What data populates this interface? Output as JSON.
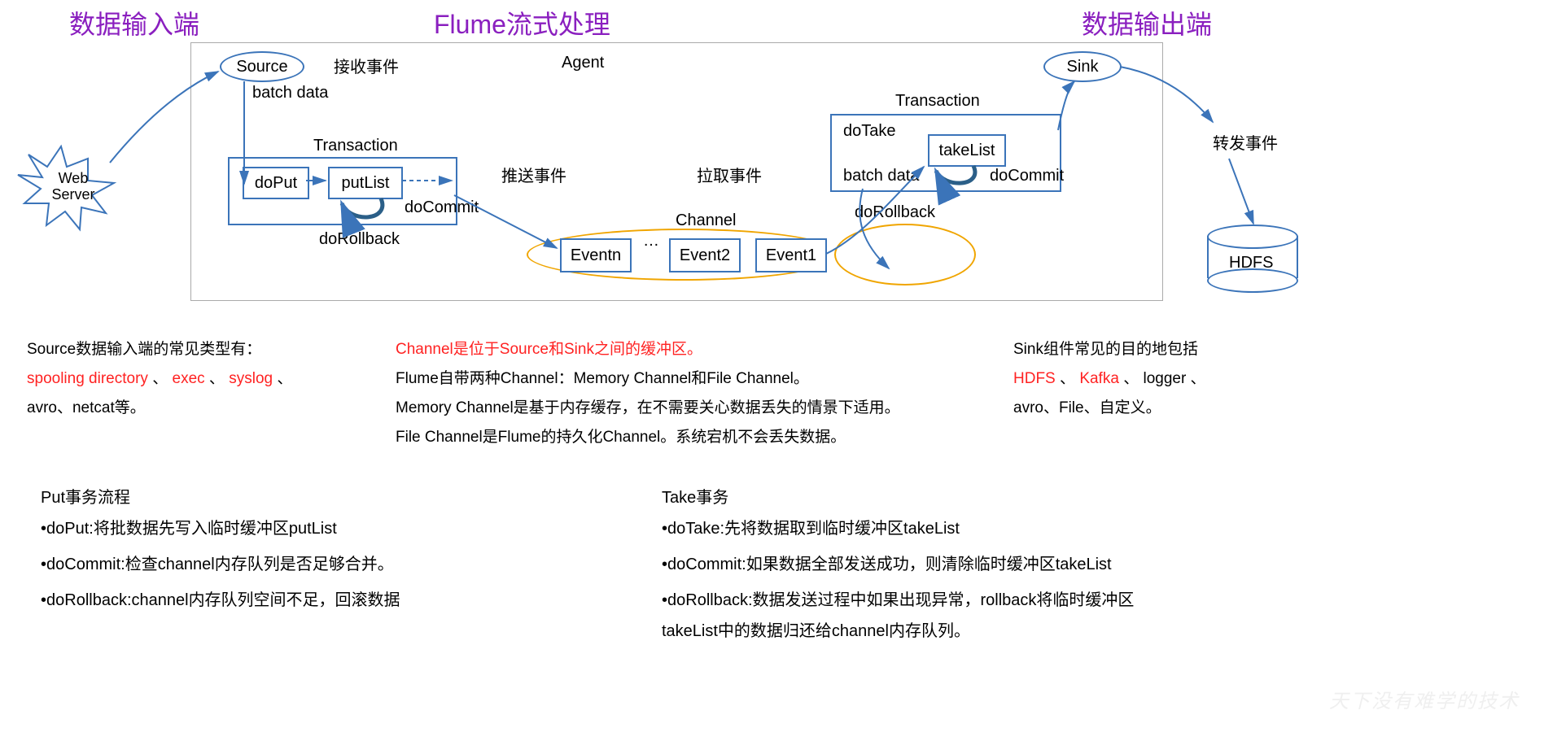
{
  "headers": {
    "left": "数据输入端",
    "center": "Flume流式处理",
    "right": "数据输出端"
  },
  "diagram": {
    "source": "Source",
    "sink": "Sink",
    "agent": "Agent",
    "recvEvent": "接收事件",
    "batchData1": "batch data",
    "txn1": "Transaction",
    "doPut": "doPut",
    "putList": "putList",
    "doCommit1": "doCommit",
    "doRollback1": "doRollback",
    "pushEvent": "推送事件",
    "pullEvent": "拉取事件",
    "channel": "Channel",
    "eventn": "Eventn",
    "event2": "Event2",
    "event1": "Event1",
    "ellipsis": "…",
    "txn2": "Transaction",
    "doTake": "doTake",
    "takeList": "takeList",
    "batchData2": "batch data",
    "doCommit2": "doCommit",
    "doRollback2": "doRollback",
    "forwardEvent": "转发事件",
    "webServer": "Web\nServer",
    "hdfs": "HDFS"
  },
  "desc": {
    "sourceLine": "Source数据输入端的常见类型有：",
    "sourceTypes1a": "spooling directory",
    "sourceTypes1b": "、",
    "sourceTypes1c": "exec",
    "sourceTypes1d": "、",
    "sourceTypes1e": "syslog",
    "sourceTypes1f": "、",
    "sourceTypes2": "avro、netcat等。",
    "chLine1": "Channel是位于Source和Sink之间的缓冲区。",
    "chLine2": "Flume自带两种Channel：Memory Channel和File Channel。",
    "chLine3": "Memory Channel是基于内存缓存，在不需要关心数据丢失的情景下适用。",
    "chLine4": "File Channel是Flume的持久化Channel。系统宕机不会丢失数据。",
    "sinkLine": "Sink组件常见的目的地包括",
    "sinkTypes1a": "HDFS",
    "sinkTypes1b": "、",
    "sinkTypes1c": "Kafka",
    "sinkTypes1d": "、  logger 、",
    "sinkTypes2": "avro、File、自定义。"
  },
  "put": {
    "title": "Put事务流程",
    "b1": "•doPut:将批数据先写入临时缓冲区putList",
    "b2": "•doCommit:检查channel内存队列是否足够合并。",
    "b3": "•doRollback:channel内存队列空间不足，回滚数据"
  },
  "take": {
    "title": "Take事务",
    "b1": "•doTake:先将数据取到临时缓冲区takeList",
    "b2": "•doCommit:如果数据全部发送成功，则清除临时缓冲区takeList",
    "b3": "•doRollback:数据发送过程中如果出现异常，rollback将临时缓冲区takeList中的数据归还给channel内存队列。"
  },
  "watermark": "天下没有难学的技术"
}
